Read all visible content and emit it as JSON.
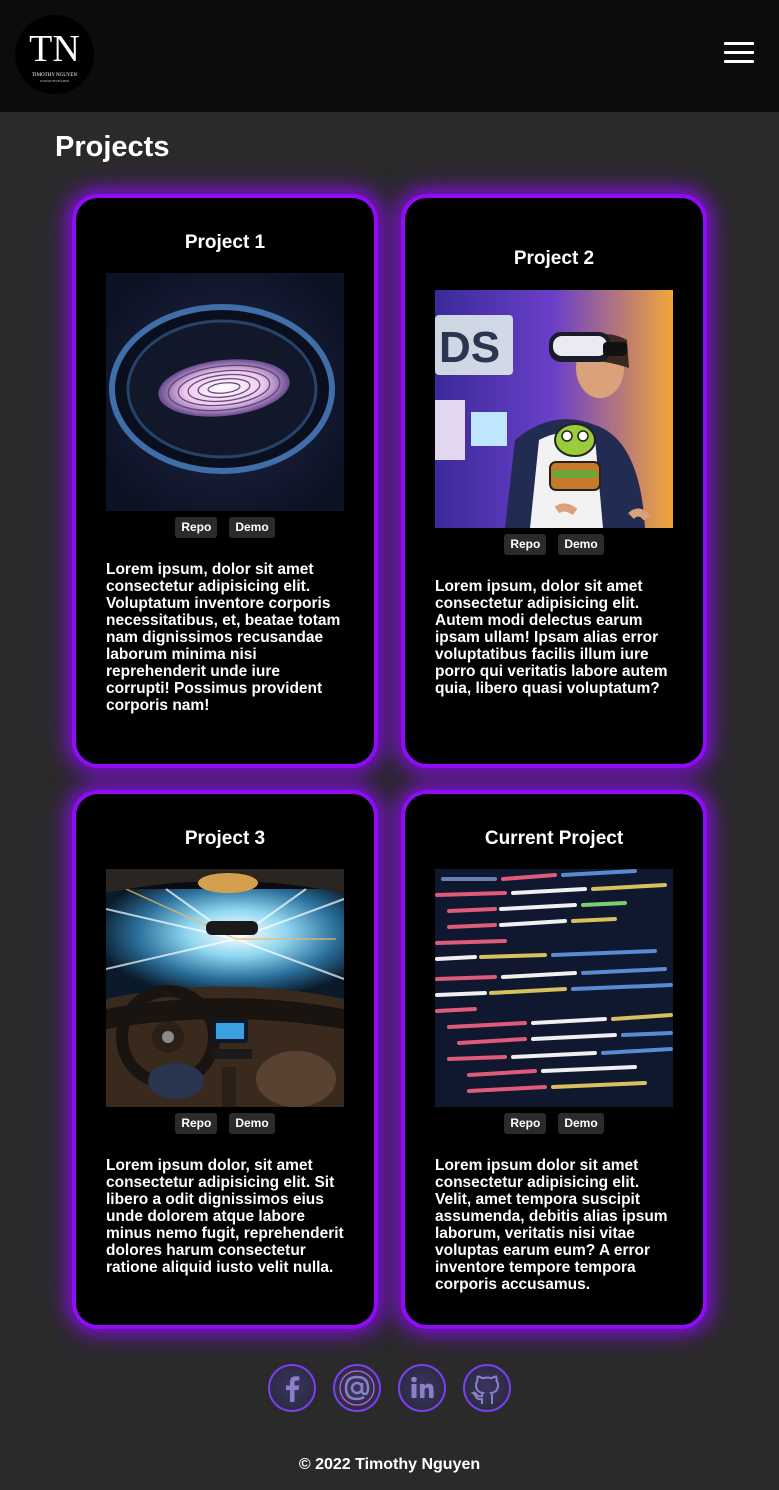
{
  "header": {
    "logo_initials": "TN",
    "logo_name": "TIMOTHY NGUYEN",
    "logo_subtitle": "JUNIOR DEVELOPER",
    "menu_icon": "hamburger-menu-icon"
  },
  "page_title": "Projects",
  "projects": [
    {
      "title": "Project 1",
      "image": "fingerprint-scanner-photo",
      "repo_label": "Repo",
      "demo_label": "Demo",
      "description": "Lorem ipsum, dolor sit amet consectetur adipisicing elit. Voluptatum inventore corporis necessitatibus, et, beatae totam nam dignissimos recusandae laborum minima nisi reprehenderit unde iure corrupti! Possimus provident corporis nam!"
    },
    {
      "title": "Project 2",
      "image": "vr-headset-photo",
      "repo_label": "Repo",
      "demo_label": "Demo",
      "description": "Lorem ipsum, dolor sit amet consectetur adipisicing elit. Autem modi delectus earum ipsam ullam! Ipsam alias error voluptatibus facilis illum iure porro qui veritatis labore autem quia, libero quasi voluptatum?"
    },
    {
      "title": "Project 3",
      "image": "car-interior-light-speed-photo",
      "repo_label": "Repo",
      "demo_label": "Demo",
      "description": "Lorem ipsum dolor, sit amet consectetur adipisicing elit. Sit libero a odit dignissimos eius unde dolorem atque labore minus nemo fugit, reprehenderit dolores harum consectetur ratione aliquid iusto velit nulla."
    },
    {
      "title": "Current Project",
      "image": "code-screen-photo",
      "repo_label": "Repo",
      "demo_label": "Demo",
      "description": "Lorem ipsum dolor sit amet consectetur adipisicing elit. Velit, amet tempora suscipit assumenda, debitis alias ipsum laborum, veritatis nisi vitae voluptas earum eum? A error inventore tempore tempora corporis accusamus."
    }
  ],
  "socials": [
    "facebook-icon",
    "email-at-icon",
    "linkedin-icon",
    "github-icon"
  ],
  "colors": {
    "glow": "#8f0cf5",
    "page_bg": "#2a2a2a",
    "header_bg": "#0c0c0c",
    "card_bg": "#000000"
  },
  "footer": {
    "copyright": "© 2022 Timothy Nguyen"
  }
}
